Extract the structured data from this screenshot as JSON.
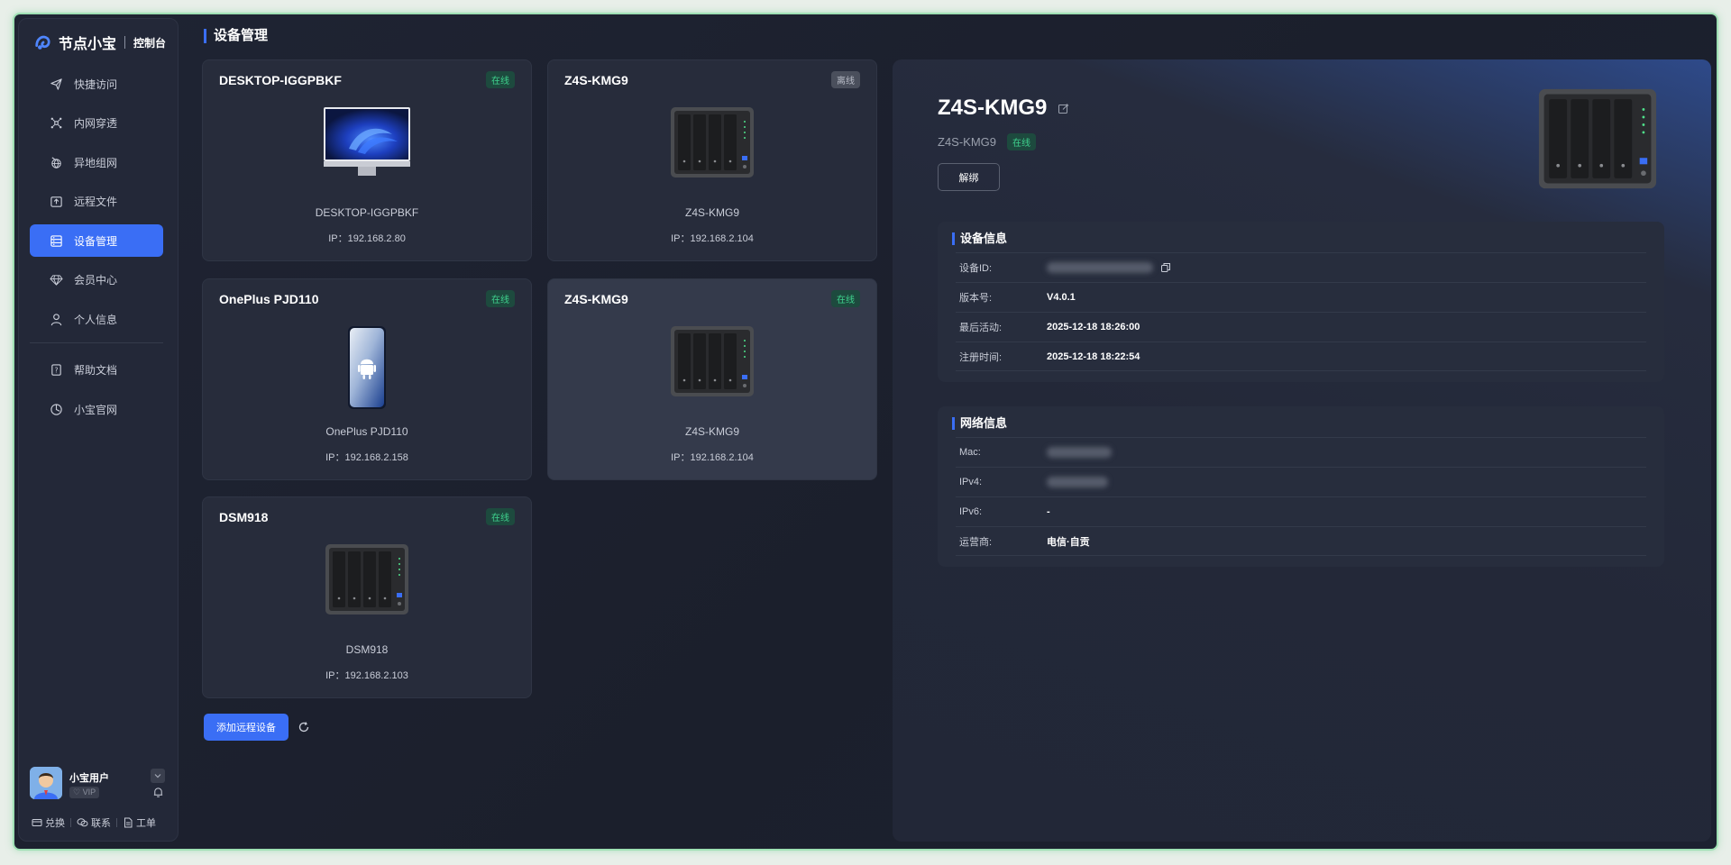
{
  "brand": {
    "name": "节点小宝",
    "sub": "控制台"
  },
  "nav": [
    {
      "label": "快捷访问",
      "icon": "send-icon"
    },
    {
      "label": "内网穿透",
      "icon": "network-icon"
    },
    {
      "label": "异地组网",
      "icon": "globe-icon"
    },
    {
      "label": "远程文件",
      "icon": "upload-folder-icon"
    },
    {
      "label": "设备管理",
      "icon": "server-icon",
      "active": true
    },
    {
      "label": "会员中心",
      "icon": "diamond-icon"
    },
    {
      "label": "个人信息",
      "icon": "user-icon"
    },
    {
      "label": "帮助文档",
      "icon": "help-doc-icon"
    },
    {
      "label": "小宝官网",
      "icon": "compass-icon"
    }
  ],
  "user": {
    "name": "小宝用户",
    "vip": "VIP"
  },
  "bottom_links": {
    "redeem": "兑换",
    "contact": "联系",
    "ticket": "工单"
  },
  "page_title": "设备管理",
  "devices": [
    {
      "title": "DESKTOP-IGGPBKF",
      "status": "在线",
      "name": "DESKTOP-IGGPBKF",
      "ip": "IP：192.168.2.80",
      "type": "pc"
    },
    {
      "title": "Z4S-KMG9",
      "status": "离线",
      "name": "Z4S-KMG9",
      "ip": "IP：192.168.2.104",
      "type": "nas"
    },
    {
      "title": "OnePlus PJD110",
      "status": "在线",
      "name": "OnePlus PJD110",
      "ip": "IP：192.168.2.158",
      "type": "phone"
    },
    {
      "title": "Z4S-KMG9",
      "status": "在线",
      "name": "Z4S-KMG9",
      "ip": "IP：192.168.2.104",
      "type": "nas",
      "selected": true
    },
    {
      "title": "DSM918",
      "status": "在线",
      "name": "DSM918",
      "ip": "IP：192.168.2.103",
      "type": "nas"
    }
  ],
  "add_button": "添加远程设备",
  "detail": {
    "title": "Z4S-KMG9",
    "subtitle": "Z4S-KMG9",
    "status": "在线",
    "unbind": "解绑",
    "device_info": {
      "title": "设备信息",
      "rows": [
        {
          "k": "设备ID:",
          "v": ""
        },
        {
          "k": "版本号:",
          "v": "V4.0.1"
        },
        {
          "k": "最后活动:",
          "v": "2025-12-18 18:26:00"
        },
        {
          "k": "注册时间:",
          "v": "2025-12-18 18:22:54"
        }
      ]
    },
    "network_info": {
      "title": "网络信息",
      "rows": [
        {
          "k": "Mac:",
          "v": ""
        },
        {
          "k": "IPv4:",
          "v": ""
        },
        {
          "k": "IPv6:",
          "v": "-"
        },
        {
          "k": "运营商:",
          "v": "电信·自贡"
        }
      ]
    }
  },
  "colors": {
    "accent": "#3a6ef5",
    "online": "#3fd38e",
    "border": "#9fe0b4"
  }
}
